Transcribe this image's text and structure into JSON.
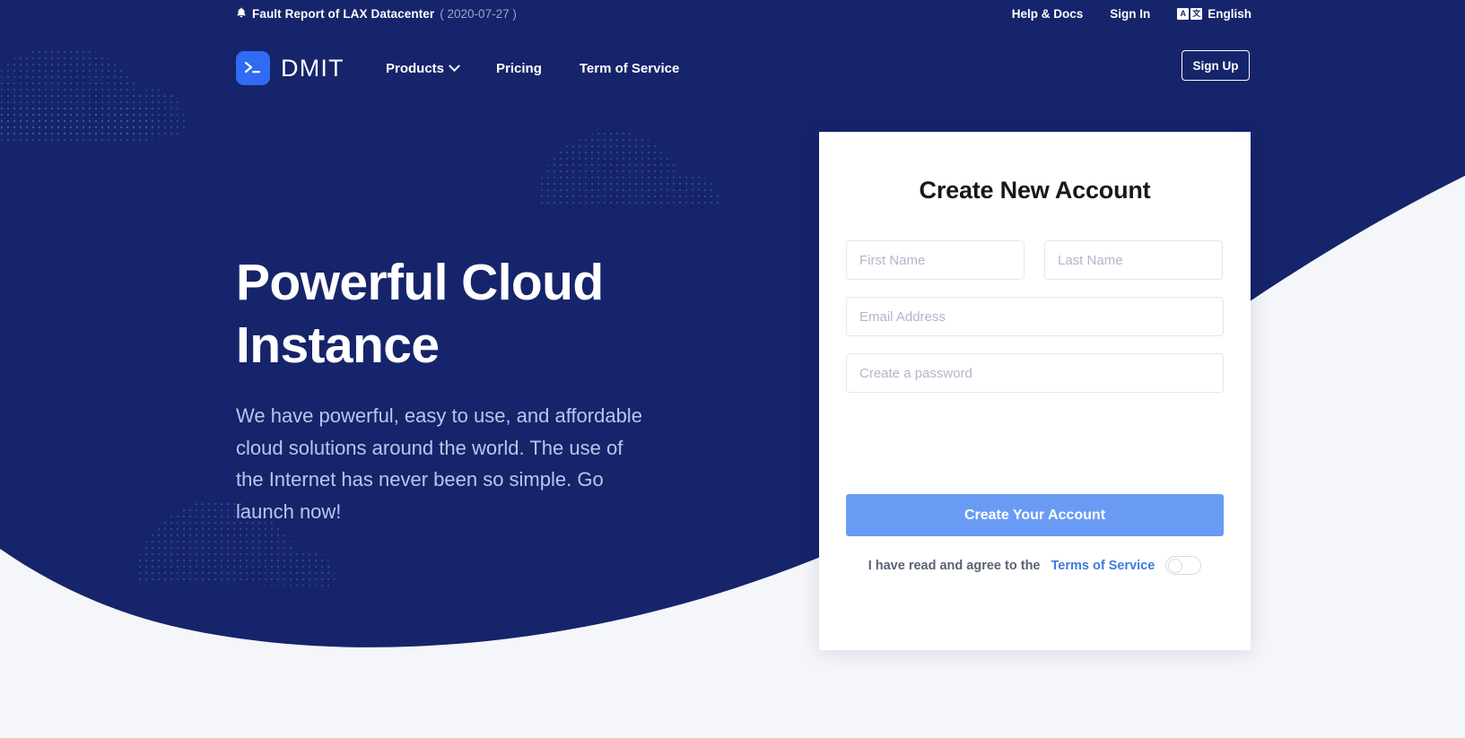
{
  "colors": {
    "navy": "#16246b",
    "page_bg": "#f4f6fa",
    "brand_blue": "#2f6bf3",
    "button_blue": "#6a9bf4",
    "link_blue": "#3d7ae0",
    "hero_sub": "#b9c6ea"
  },
  "announcement": {
    "bell_icon": "bell-icon",
    "title": "Fault Report of LAX Datacenter",
    "date": "( 2020-07-27 )"
  },
  "top_nav": {
    "help_docs": "Help & Docs",
    "sign_in": "Sign In",
    "language": {
      "icon": "translate-icon",
      "box_latin": "A",
      "box_cjk": "文",
      "label": "English"
    }
  },
  "navbar": {
    "logo_icon": "terminal-prompt-icon",
    "brand": "DMIT",
    "links": [
      {
        "label": "Products",
        "has_dropdown": true,
        "icon": "chevron-down-icon"
      },
      {
        "label": "Pricing",
        "has_dropdown": false
      },
      {
        "label": "Term of Service",
        "has_dropdown": false
      }
    ],
    "signup_label": "Sign Up"
  },
  "hero": {
    "title_line1": "Powerful Cloud",
    "title_line2": "Instance",
    "subtitle": "We have powerful, easy to use, and affordable cloud solutions around the world. The use of the Internet has never been so simple. Go launch now!"
  },
  "signup_card": {
    "title": "Create New Account",
    "fields": {
      "first_name_placeholder": "First Name",
      "last_name_placeholder": "Last Name",
      "email_placeholder": "Email Address",
      "password_placeholder": "Create a password",
      "first_name_value": "",
      "last_name_value": "",
      "email_value": "",
      "password_value": ""
    },
    "submit_label": "Create Your Account",
    "terms_text": "I have read and agree to the",
    "terms_link": "Terms of Service",
    "terms_accepted": false
  }
}
